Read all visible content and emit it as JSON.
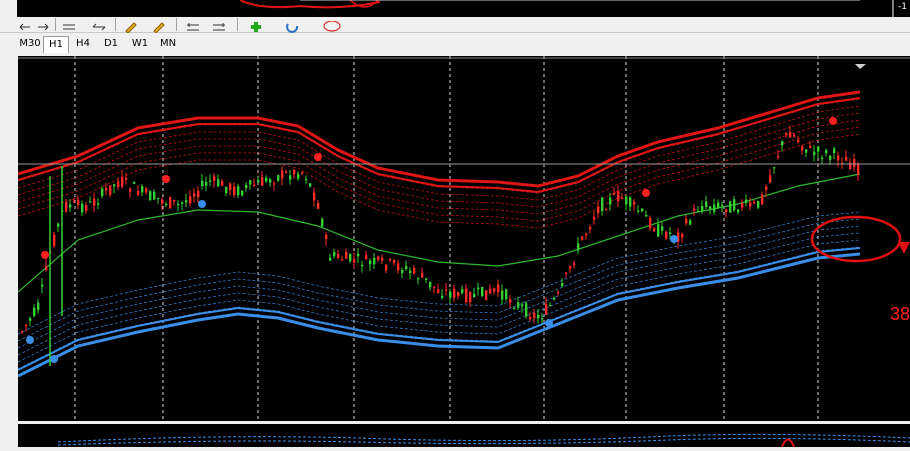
{
  "timeframes": [
    {
      "label": "M30",
      "active": false
    },
    {
      "label": "H1",
      "active": true
    },
    {
      "label": "H4",
      "active": false
    },
    {
      "label": "D1",
      "active": false
    },
    {
      "label": "W1",
      "active": false
    },
    {
      "label": "MN",
      "active": false
    }
  ],
  "price_label": "38",
  "corner_label": "-1",
  "colors": {
    "upper_band": "#e01515",
    "lower_band": "#3a8ee8",
    "mid_line": "#2fb82f",
    "bull_candle": "#35d035",
    "bear_candle": "#ff2b2b",
    "annotation": "#e01010",
    "grid": "#ffffff"
  },
  "icons": [
    "arrow-left-icon",
    "arrow-right-icon",
    "arrows-icon",
    "pencil-icon",
    "pencil-icon",
    "arrows-h-icon",
    "arrows-h-icon",
    "plus-icon",
    "circle-icon"
  ]
}
